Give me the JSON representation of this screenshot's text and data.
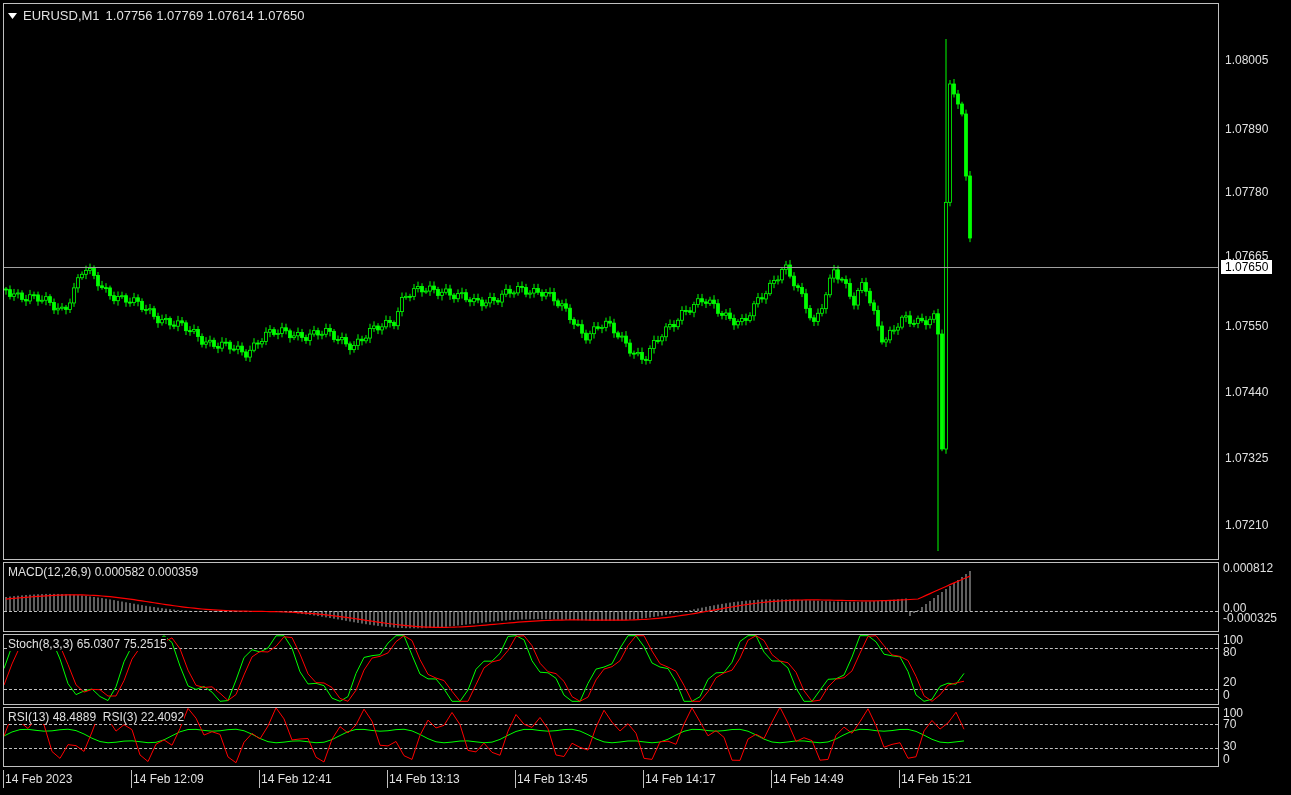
{
  "chart_header": {
    "symbol": "EURUSD,M1",
    "values": "1.07756 1.07769 1.07614 1.07650"
  },
  "price_axis": {
    "ticks": [
      "1.08005",
      "1.07890",
      "1.07780",
      "1.07665",
      "1.07550",
      "1.07440",
      "1.07325",
      "1.07210"
    ],
    "current_price": "1.07650"
  },
  "indicator_panes": [
    {
      "kind": "macd",
      "label": "MACD(12,26,9) 0.000582 0.000359",
      "ticks": [
        "0.000812",
        "0.00",
        "-0.000325"
      ]
    },
    {
      "kind": "stoch",
      "label": "Stoch(8,3,3) 65.0307 75.2515",
      "ticks": [
        "100",
        "80",
        "20",
        "0"
      ]
    },
    {
      "kind": "rsi",
      "label": "RSI(13) 48.4889  RSI(3) 22.4092",
      "ticks": [
        "100",
        "70",
        "30",
        "0"
      ]
    }
  ],
  "time_axis": [
    "14 Feb 2023",
    "14 Feb 12:09",
    "14 Feb 12:41",
    "14 Feb 13:13",
    "14 Feb 13:45",
    "14 Feb 14:17",
    "14 Feb 14:49",
    "14 Feb 15:21"
  ]
}
